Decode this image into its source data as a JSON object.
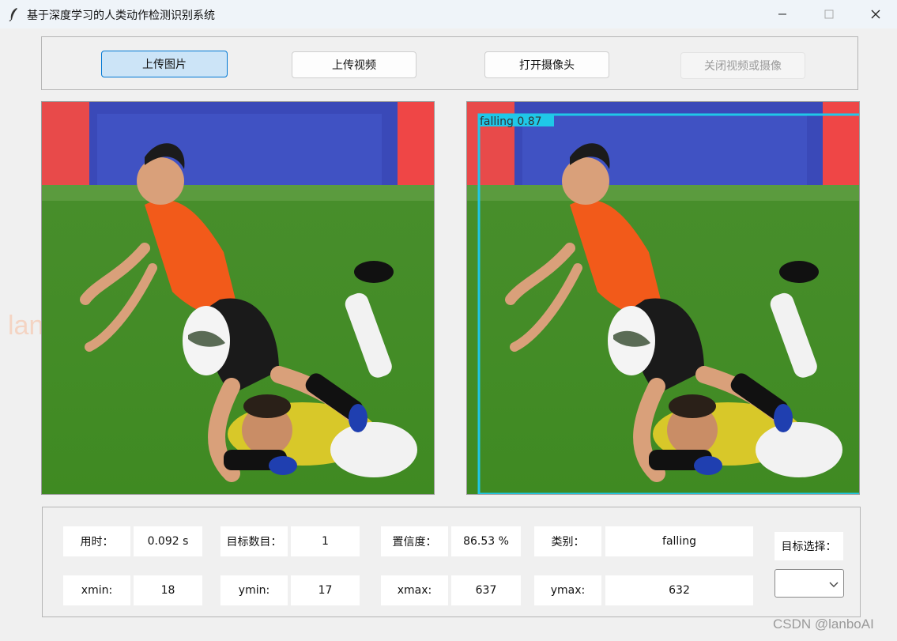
{
  "window": {
    "title": "基于深度学习的人类动作检测识别系统"
  },
  "toolbar": {
    "upload_image": "上传图片",
    "upload_video": "上传视频",
    "open_camera": "打开摄像头",
    "close_video": "关闭视频或摄像"
  },
  "result": {
    "detection_label": "falling 0.87",
    "box_color": "#1fc8e8"
  },
  "watermark": "lanboAI",
  "info": {
    "time_label": "用时：",
    "time_value": "0.092 s",
    "count_label": "目标数目：",
    "count_value": "1",
    "conf_label": "置信度：",
    "conf_value": "86.53 %",
    "class_label": "类别：",
    "class_value": "falling",
    "xmin_label": "xmin:",
    "xmin_value": "18",
    "ymin_label": "ymin:",
    "ymin_value": "17",
    "xmax_label": "xmax:",
    "xmax_value": "637",
    "ymax_label": "ymax:",
    "ymax_value": "632",
    "target_select_label": "目标选择：",
    "target_select_value": ""
  },
  "footer": {
    "credit": "CSDN @lanboAI"
  },
  "colors": {
    "accent": "#0078d4",
    "button_active_bg": "#cce4f7"
  }
}
